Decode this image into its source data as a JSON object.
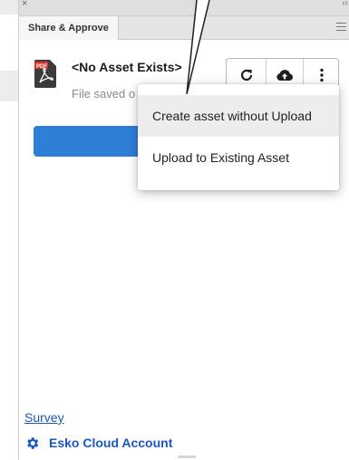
{
  "panel": {
    "close_glyph": "×",
    "collapse_glyph": "‹‹",
    "tab_label": "Share & Approve"
  },
  "asset": {
    "title": "<No Asset Exists>",
    "saved_text": "File saved o",
    "file_icon": "pdf-file-icon"
  },
  "toolbar": {
    "buttons": [
      {
        "icon": "refresh-icon"
      },
      {
        "icon": "cloud-upload-icon"
      },
      {
        "icon": "more-vertical-icon"
      }
    ]
  },
  "dropdown": {
    "items": [
      {
        "label": "Create asset without Upload"
      },
      {
        "label": "Upload to Existing Asset"
      }
    ]
  },
  "footer": {
    "survey_link": "Survey",
    "account_label": "Esko Cloud Account"
  },
  "colors": {
    "accent_blue": "#2f7ed8",
    "link_blue": "#1a57c2",
    "pdf_red": "#d9332b",
    "icon_dark": "#222222"
  }
}
